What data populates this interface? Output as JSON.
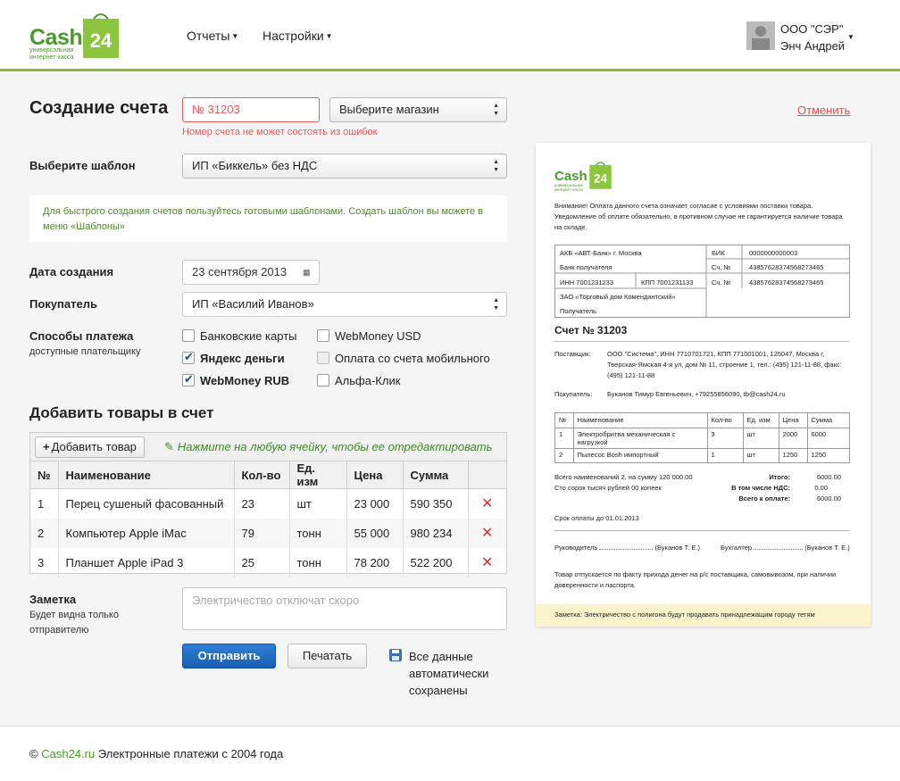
{
  "header": {
    "logo_text": "Cash",
    "logo_num": "24",
    "logo_sub": "универсальная интернет касса",
    "nav": [
      {
        "label": "Отчеты"
      },
      {
        "label": "Настройки"
      }
    ],
    "company": "ООО \"СЭР\"",
    "user": "Энч Андрей"
  },
  "form": {
    "title": "Создание счета",
    "invoice_number": "№ 31203",
    "invoice_error": "Номер счета не может состоять из ошибок",
    "shop_select": "Выберите магазин",
    "cancel": "Отменить",
    "template_label": "Выберите шаблон",
    "template_value": "ИП «Биккель» без НДС",
    "hint": "Для быстрого создания счетов пользуйтесь готовыми шаблонами. Создать шаблон вы можете в меню «Шаблоны»",
    "date_label": "Дата создания",
    "date_value": "23 сентября 2013",
    "buyer_label": "Покупатель",
    "buyer_value": "ИП «Василий Иванов»",
    "payment_label": "Способы платежа",
    "payment_sublabel": "доступные плательщику",
    "payment_methods": [
      {
        "label": "Банковские карты",
        "checked": false
      },
      {
        "label": "Яндекс деньги",
        "checked": true
      },
      {
        "label": "WebMoney RUB",
        "checked": true
      },
      {
        "label": "WebMoney USD",
        "checked": false
      },
      {
        "label": "Оплата со счета мобильного",
        "checked": false
      },
      {
        "label": "Альфа-Клик",
        "checked": false
      }
    ],
    "items_title": "Добавить товары в счет",
    "add_item": "Добавить товар",
    "table_hint": "Нажмите на любую ячейку, чтобы ее отредактировать",
    "columns": [
      "№",
      "Наименование",
      "Кол-во",
      "Ед. изм",
      "Цена",
      "Сумма"
    ],
    "rows": [
      {
        "n": "1",
        "name": "Перец сушеный фасованный",
        "qty": "23",
        "unit": "шт",
        "price": "23 000",
        "sum": "590 350"
      },
      {
        "n": "2",
        "name": "Компьютер Apple iMac",
        "qty": "79",
        "unit": "тонн",
        "price": "55 000",
        "sum": "980 234"
      },
      {
        "n": "3",
        "name": "Планшет Apple iPad 3",
        "qty": "25",
        "unit": "тонн",
        "price": "78 200",
        "sum": "522 200"
      }
    ],
    "note_label": "Заметка",
    "note_sublabel": "Будет видна только отправителю",
    "note_placeholder": "Электричество отключат скоро",
    "send": "Отправить",
    "print": "Печатать",
    "saved": "Все данные автоматически сохранены"
  },
  "invoice": {
    "warning": "Внимание! Оплата данного счета означает согласие с условиями поставки товара. Уведомление об оплате обязательно, в противном случае не гарантируется наличие товара на складе.",
    "bank_name": "АКБ «АВТ-Банк» г. Москва",
    "bank_recipient": "Банк получателя",
    "bik_label": "БИК",
    "bik": "0000000000003",
    "acc_label": "Сч. №",
    "acc1": "43857628374568273465",
    "inn": "ИНН    7001231233",
    "kpp": "КПП    7001231133",
    "acc2": "43857628374568273465",
    "recipient": "ЗАО «Торговый дом Комендантский»",
    "recipient_label": "Получатель",
    "title": "Счет № 31203",
    "supplier_label": "Поставщик:",
    "supplier": "ООО \"Система\", ИНН 7710701721, КПП 771001001, 125047, Москва г, Тверская-Ямская 4-я ул, дом № 11, строение 1, тел.: (495) 121-11-88, факс: (495) 121-11-88",
    "buyer_label": "Покупатель:",
    "buyer": "Буканов Тимур Евгеньевич, +79255856090, tb@cash24.ru",
    "columns": [
      "№",
      "Наименование",
      "Кол-во",
      "Ед. изм",
      "Цена",
      "Сумма"
    ],
    "rows": [
      {
        "n": "1",
        "name": "Электробритва механическая с нагрузкой",
        "qty": "3",
        "unit": "шт",
        "price": "2000",
        "sum": "6000"
      },
      {
        "n": "2",
        "name": "Пылесос Bosh импортный",
        "qty": "1",
        "unit": "шт",
        "price": "1250",
        "sum": "1250"
      }
    ],
    "total_names_label": "Всего наименований 2, на сумму",
    "total_names_value": "120 000.00",
    "total_words": "Сто сорок тысяч рублей 00 копеек",
    "itogo_label": "Итого:",
    "itogo": "6000.00",
    "nds_label": "В том числе НДС:",
    "nds": "0.00",
    "to_pay_label": "Всего к оплате:",
    "to_pay": "6000.00",
    "due": "Срок оплаты до 01.01.2013",
    "head_label": "Руководитель",
    "head_sign": "(Буканов Т. Е.)",
    "accountant_label": "Бухгалтер",
    "accountant_sign": "(Буканов Т. Е.)",
    "release_note": "Товар отпускается по факту прихода денег на р/с поставщика, самовывозом, при наличии доверенности и паспорта.",
    "footer_note": "Заметка: Электричество с полигона будут продавать принадлежащим городу тетям"
  },
  "footer": {
    "copyright": "©",
    "link": "Cash24.ru",
    "text": "Электронные платежи с 2004 года"
  },
  "colors": {
    "brand": "#4b9a2c",
    "primary": "#1a5fb4",
    "error": "#e65a5a"
  }
}
